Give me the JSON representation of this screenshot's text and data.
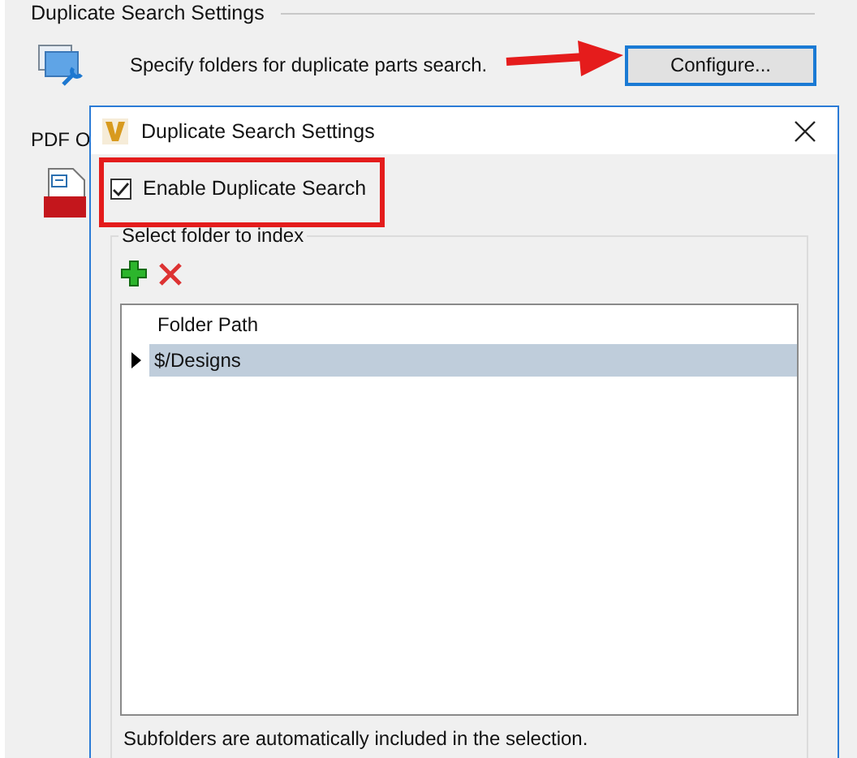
{
  "background_panel": {
    "section_title": "Duplicate Search Settings",
    "description": "Specify folders for duplicate parts search.",
    "configure_button": "Configure...",
    "pdf_section_title": "PDF O"
  },
  "dialog": {
    "title": "Duplicate Search Settings",
    "enable_checkbox": {
      "label": "Enable Duplicate Search",
      "checked": true
    },
    "group_title": "Select folder to index",
    "grid": {
      "columns": [
        "Folder Path"
      ],
      "rows": [
        {
          "cells": [
            "$/Designs"
          ],
          "selected": true
        }
      ]
    },
    "note": "Subfolders are automatically included in the selection."
  }
}
